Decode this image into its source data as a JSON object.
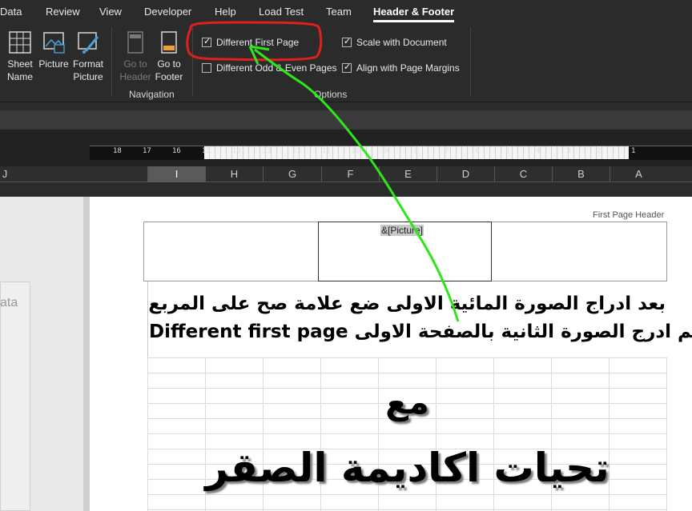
{
  "menu": {
    "tabs": [
      {
        "label": "Data"
      },
      {
        "label": "Review"
      },
      {
        "label": "View"
      },
      {
        "label": "Developer"
      },
      {
        "label": "Help"
      },
      {
        "label": "Load Test"
      },
      {
        "label": "Team"
      },
      {
        "label": "Header & Footer"
      }
    ],
    "active_tab": "Header & Footer"
  },
  "ribbon": {
    "elements": {
      "sheet_name": {
        "line1": "Sheet",
        "line2": "Name"
      },
      "picture": {
        "label": "Picture"
      },
      "format_picture": {
        "line1": "Format",
        "line2": "Picture"
      }
    },
    "navigation": {
      "goto_header": {
        "line1": "Go to",
        "line2": "Header"
      },
      "goto_footer": {
        "line1": "Go to",
        "line2": "Footer"
      },
      "group_label": "Navigation"
    },
    "options": {
      "different_first_page": {
        "label": "Different First Page",
        "checked": true
      },
      "different_odd_even": {
        "label": "Different Odd & Even Pages",
        "checked": false
      },
      "scale_with_document": {
        "label": "Scale with Document",
        "checked": true
      },
      "align_page_margins": {
        "label": "Align with Page Margins",
        "checked": true
      },
      "group_label": "Options"
    }
  },
  "ruler": {
    "ticks": [
      "18",
      "17",
      "16",
      "15",
      "14",
      "13",
      "12",
      "11",
      "10",
      "9",
      "8",
      "7",
      "6",
      "5",
      "4",
      "3",
      "2",
      "1"
    ]
  },
  "columns": [
    "J",
    "I",
    "H",
    "G",
    "F",
    "E",
    "D",
    "C",
    "B",
    "A"
  ],
  "selected_column": "I",
  "left_pane": {
    "partial_text": "ata"
  },
  "page": {
    "header_label": "First Page Header",
    "picture_field": "&[Picture]",
    "instruction_line1": "بعد ادراج الصورة المائية الاولى ضع علامة صح على المربع",
    "instruction_line2_en": "Different first page",
    "instruction_line2_ar": "ثم ادرج الصورة الثانية بالصفحة الاولى",
    "big_line1": "مع",
    "big_line2": "تحيات اكاديمة الصقر"
  },
  "annotation": {
    "highlight_color": "#e0201c",
    "arrow_color": "#2ee61a"
  }
}
